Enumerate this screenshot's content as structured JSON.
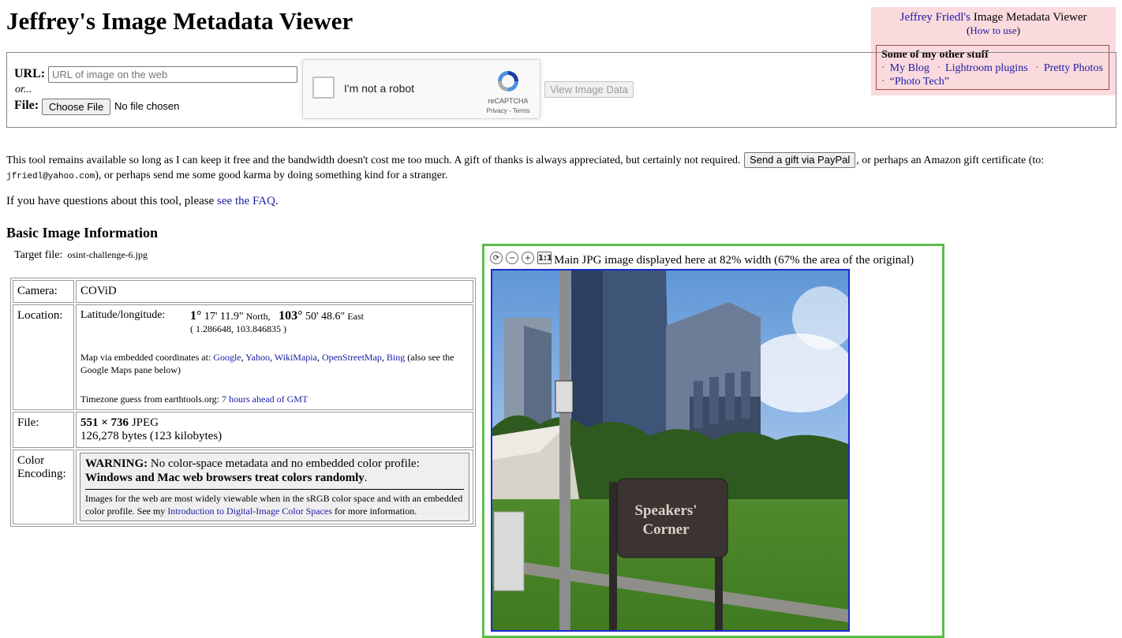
{
  "page": {
    "title": "Jeffrey's Image Metadata Viewer"
  },
  "other_box": {
    "title_link": "Jeffrey Friedl's",
    "title_rest": " Image Metadata Viewer",
    "howto_open": "(",
    "howto_link": "How to use",
    "howto_close": ")",
    "heading": "Some of my other stuff",
    "links": [
      "My Blog",
      "Lightroom plugins",
      "Pretty Photos",
      "“Photo Tech”"
    ]
  },
  "form": {
    "url_label": "URL:",
    "url_placeholder": "URL of image on the web",
    "or_text": "or...",
    "file_label": "File:",
    "file_button": "Choose File",
    "file_status": "No file chosen",
    "captcha_label": "I'm not a robot",
    "captcha_brand": "reCAPTCHA",
    "captcha_terms": "Privacy - Terms",
    "view_button": "View Image Data"
  },
  "gift": {
    "text_1": "This tool remains available so long as I can keep it free and the bandwidth doesn't cost me too much. A gift of thanks is always appreciated, but certainly not required. ",
    "paypal_button": "Send a gift via PayPal",
    "text_2": ", or perhaps an Amazon gift certificate (to: ",
    "email": "jfriedl@yahoo.com",
    "text_3": "), or perhaps send me some good karma by doing something kind for a stranger."
  },
  "faq": {
    "text": "If you have questions about this tool, please ",
    "link": "see the FAQ",
    "end": "."
  },
  "basic": {
    "heading": "Basic Image Information",
    "target_label": "Target file:",
    "target_file": "osint-challenge-6.jpg"
  },
  "info": {
    "camera_label": "Camera:",
    "camera_value": "COViD",
    "location_label": "Location:",
    "latlon_label": "Latitude/longitude:",
    "lat_deg": "1°",
    "lat_rest": " 17' 11.9\"",
    "lat_dir": " North,",
    "lon_deg": "103°",
    "lon_rest": " 50' 48.6\"",
    "lon_dir": " East",
    "decimal": "( 1.286648, 103.846835 )",
    "map_text": "Map via embedded coordinates at: ",
    "map_links": [
      "Google",
      "Yahoo",
      "WikiMapia",
      "OpenStreetMap",
      "Bing"
    ],
    "map_tail": " (also see the Google Maps pane below)",
    "tz_text": "Timezone guess from earthtools.org: ",
    "tz_link": "7 hours ahead of GMT",
    "file_label": "File:",
    "file_dims": "551 × 736",
    "file_type": " JPEG",
    "file_bytes": "126,278 bytes (123 kilobytes)",
    "color_label": "Color Encoding:",
    "warn_bold": "WARNING:",
    "warn_text": " No color-space metadata and no embedded color profile:",
    "warn_line2": "Windows and Mac web browsers treat colors randomly",
    "warn_period": ".",
    "warn_body": "Images for the web are most widely viewable when in the sRGB color space and with an embedded color profile. See my ",
    "warn_link": "Introduction to Digital-Image Color Spaces",
    "warn_end": " for more information."
  },
  "image_panel": {
    "caption": "Main JPG image displayed here at 82% width (67% the area of the original)",
    "tool_one": "1:1",
    "sign_line1": "Speakers'",
    "sign_line2": "Corner",
    "colors": {
      "panel_border": "#5cbd4c",
      "photo_border": "#1a2ad0"
    }
  }
}
